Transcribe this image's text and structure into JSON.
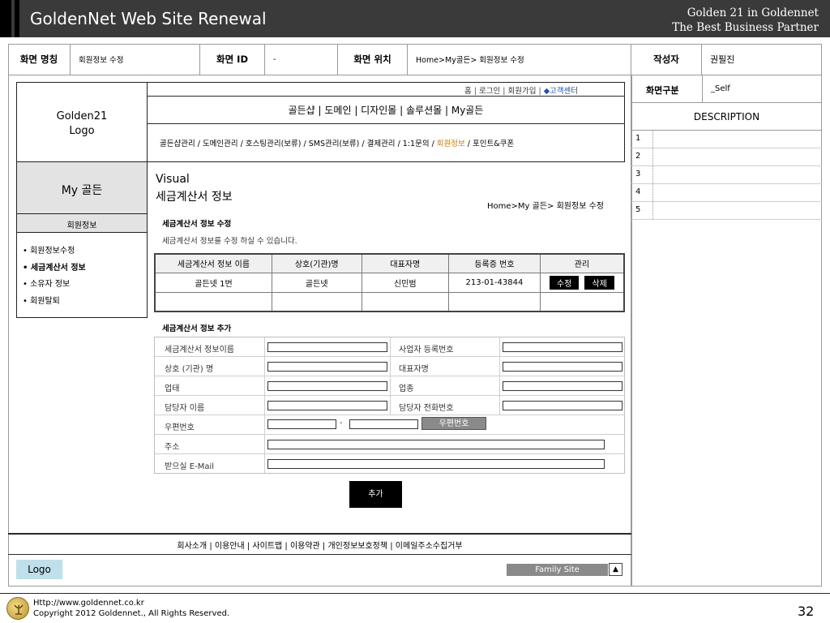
{
  "header": {
    "title": "GoldenNet Web Site Renewal",
    "subtitle_line1": "Golden 21 in Goldennet",
    "subtitle_line2": "The Best Business Partner"
  },
  "meta": {
    "screen_name_label": "화면 명칭",
    "screen_name_value": "회원정보 수정",
    "screen_id_label": "화면 ID",
    "screen_id_value": "-",
    "screen_loc_label": "화면 위치",
    "screen_loc_value": "Home>My골든> 회원정보 수정",
    "author_label": "작성자",
    "author_value": "권필진"
  },
  "right_panel": {
    "type_label": "화면구분",
    "type_value": "_Self",
    "description_title": "DESCRIPTION",
    "rows": [
      "1",
      "2",
      "3",
      "4",
      "5"
    ]
  },
  "site": {
    "logo_line1": "Golden21",
    "logo_line2": "Logo",
    "util_links": [
      "홈",
      "로그인",
      "회원가입"
    ],
    "util_customer": "◆고객센터",
    "gnb": "골든샵 | 도메인 | 디자인몰 | 솔루션몰 | My골든",
    "lnb_before": "골든샵관리 / 도메인관리 / 호스팅관리(보류) / SMS관리(보류) / 결제관리 / 1:1문의 / ",
    "lnb_active": "회원정보",
    "lnb_after": " / 포인트&쿠폰",
    "my_title": "My 골든",
    "visual_line1": "Visual",
    "visual_line2": "세금계산서 정보",
    "breadcrumb": "Home>My 골든> 회원정보 수정"
  },
  "sidebar": {
    "section": "회원정보",
    "items": [
      "• 회원정보수정",
      "• 세금계산서 정보",
      "• 소유자 정보",
      "• 회원탈퇴"
    ]
  },
  "tax_edit": {
    "heading": "세금계산서 정보 수정",
    "desc": "세금계산서 정보를 수정 하실 수 있습니다.",
    "columns": [
      "세금계산서 정보 이름",
      "상호(기관)명",
      "대표자명",
      "등록증 번호",
      "관리"
    ],
    "row": {
      "name": "골든넷 1번",
      "company": "골든넷",
      "ceo": "신민범",
      "reg_no": "213-01-43844",
      "edit_label": "수정",
      "delete_label": "삭제"
    }
  },
  "tax_add": {
    "heading": "세금계산서 정보 추가",
    "fields": {
      "info_name": "세금계산서 정보이름",
      "biz_no": "사업자 등록번호",
      "company": "상호 (기관) 명",
      "ceo": "대표자명",
      "biz_type": "업태",
      "biz_item": "업종",
      "manager": "담당자 이름",
      "manager_phone": "담당자 전화번호",
      "zip": "우편번호",
      "zip_sep": "-",
      "zip_button": "우편번호",
      "address": "주소",
      "email": "받으실 E-Mail"
    },
    "submit": "추가"
  },
  "footer": {
    "links": "회사소개 | 이용안내 | 사이트맵 | 이용약관 | 개인정보보호정책 | 이메일주소수집거부",
    "logo": "Logo",
    "family_site": "Family Site",
    "family_arrow": "▲"
  },
  "slide_footer": {
    "url": "Http://www.goldennet.co.kr",
    "copyright": "Copyright 2012 Goldennet., All Rights Reserved.",
    "page": "32"
  }
}
